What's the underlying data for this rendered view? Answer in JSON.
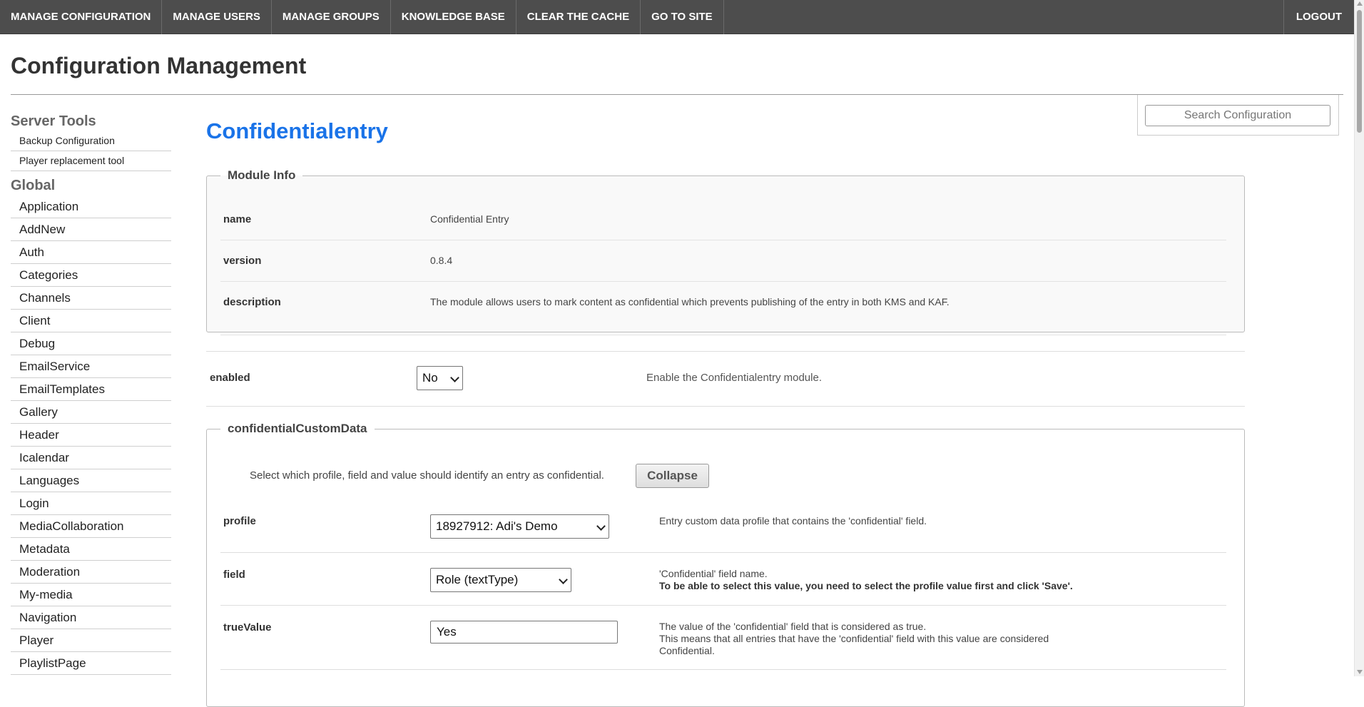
{
  "nav": {
    "items": [
      "MANAGE CONFIGURATION",
      "MANAGE USERS",
      "MANAGE GROUPS",
      "KNOWLEDGE BASE",
      "CLEAR THE CACHE",
      "GO TO SITE"
    ],
    "logout": "LOGOUT"
  },
  "page": {
    "title": "Configuration Management"
  },
  "search": {
    "placeholder": "Search Configuration"
  },
  "sidebar": {
    "server_tools_heading": "Server Tools",
    "server_tools": [
      "Backup Configuration",
      "Player replacement tool"
    ],
    "global_heading": "Global",
    "global_items": [
      "Application",
      "AddNew",
      "Auth",
      "Categories",
      "Channels",
      "Client",
      "Debug",
      "EmailService",
      "EmailTemplates",
      "Gallery",
      "Header",
      "Icalendar",
      "Languages",
      "Login",
      "MediaCollaboration",
      "Metadata",
      "Moderation",
      "My-media",
      "Navigation",
      "Player",
      "PlaylistPage"
    ]
  },
  "module": {
    "title": "Confidentialentry",
    "info_legend": "Module Info",
    "info": [
      {
        "key": "name",
        "value": "Confidential Entry"
      },
      {
        "key": "version",
        "value": "0.8.4"
      },
      {
        "key": "description",
        "value": "The module allows users to mark content as confidential which prevents publishing of the entry in both KMS and KAF."
      }
    ],
    "enabled": {
      "label": "enabled",
      "value": "No",
      "description": "Enable the Confidentialentry module."
    },
    "custom": {
      "legend": "confidentialCustomData",
      "intro": "Select which profile, field and value should identify an entry as confidential.",
      "collapse_label": "Collapse",
      "profile": {
        "label": "profile",
        "value": "18927912: Adi's Demo",
        "description": "Entry custom data profile that contains the 'confidential' field."
      },
      "field": {
        "label": "field",
        "value": "Role (textType)",
        "description": "'Confidential' field name.",
        "note": "To be able to select this value, you need to select the profile value first and click 'Save'."
      },
      "trueValue": {
        "label": "trueValue",
        "value": "Yes",
        "description_line1": "The value of the 'confidential' field that is considered as true.",
        "description_line2": "This means that all entries that have the 'confidential' field with this value are considered Confidential."
      }
    }
  }
}
